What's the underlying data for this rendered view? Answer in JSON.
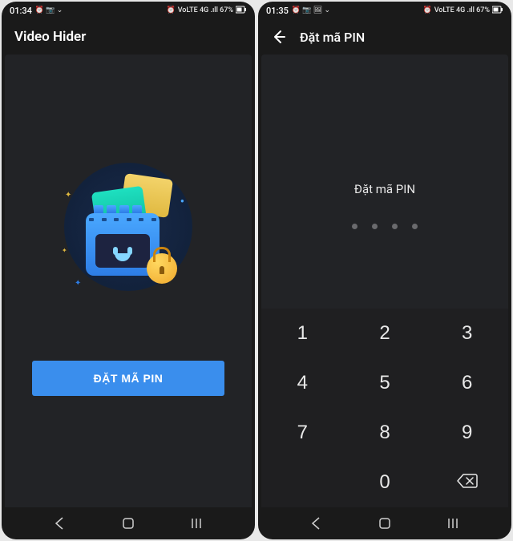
{
  "screen1": {
    "status": {
      "time": "01:34",
      "indicators": "⏰ 📷 ⌄",
      "right": "VoLTE 4G .ıll 67%",
      "battery_icon": "battery-67-icon"
    },
    "app_title": "Video Hider",
    "cta_label": "ĐẶT MÃ PIN"
  },
  "screen2": {
    "status": {
      "time": "01:35",
      "indicators": "⏰ 📷 🖼 ⌄",
      "right": "VoLTE 4G .ıll 67%",
      "battery_icon": "battery-67-icon"
    },
    "header_title": "Đặt mã PIN",
    "prompt": "Đặt mã PIN",
    "pin_length": 4,
    "keypad": [
      "1",
      "2",
      "3",
      "4",
      "5",
      "6",
      "7",
      "8",
      "9",
      "",
      "0",
      "del"
    ]
  }
}
